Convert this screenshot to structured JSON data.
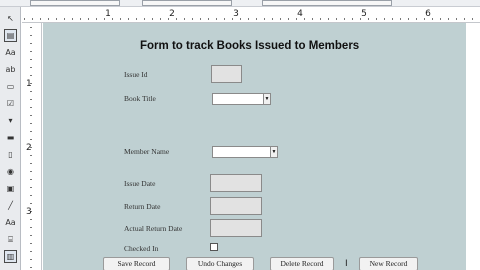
{
  "ruler": {
    "horizontal_numbers": [
      "1",
      "2",
      "3",
      "4",
      "5",
      "6"
    ],
    "vertical_numbers": [
      "1",
      "2",
      "3"
    ]
  },
  "form": {
    "title": "Form to track Books Issued to Members",
    "fields": {
      "issue_id": {
        "label": "Issue Id",
        "value": ""
      },
      "book_title": {
        "label": "Book Title",
        "value": ""
      },
      "member_name": {
        "label": "Member Name",
        "value": ""
      },
      "issue_date": {
        "label": "Issue Date",
        "value": ""
      },
      "return_date": {
        "label": "Return Date",
        "value": ""
      },
      "actual_return_date": {
        "label": "Actual Return Date",
        "value": ""
      },
      "checked_in": {
        "label": "Checked In",
        "checked": false
      }
    },
    "buttons": {
      "save": "Save Record",
      "undo": "Undo Changes",
      "delete": "Delete Record",
      "new": "New Record"
    }
  },
  "toolbox": {
    "icons": [
      "pointer-icon",
      "form-icon",
      "label-icon",
      "textbox-icon",
      "option-group-icon",
      "checkbox-icon",
      "combo-box-icon",
      "button-icon",
      "toggle-icon",
      "radio-icon",
      "image-icon",
      "line-icon",
      "page-break-icon",
      "tab-control-icon",
      "rectangle-icon",
      "subform-icon"
    ]
  },
  "colors": {
    "canvas": "#bfd0d2",
    "field_background": "#e2e2e2"
  }
}
